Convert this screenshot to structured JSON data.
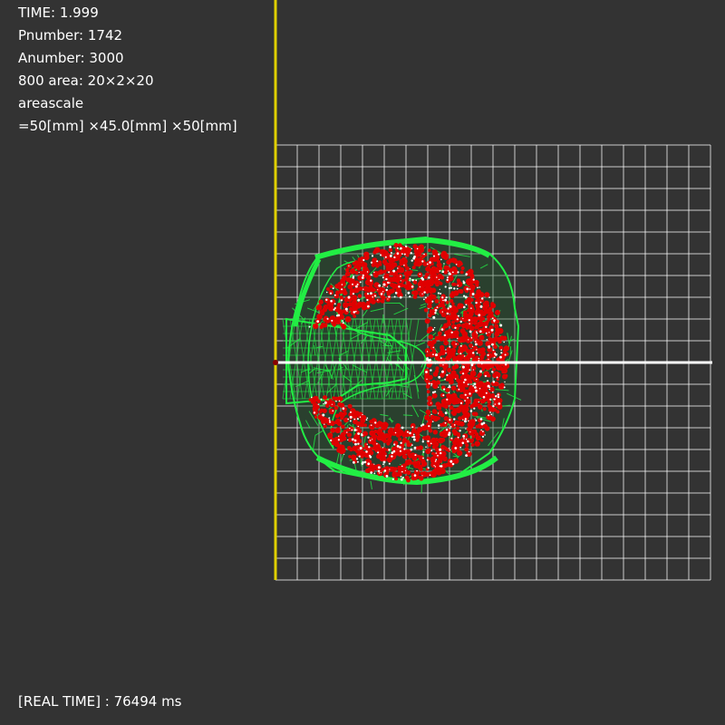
{
  "hud": {
    "time": "TIME: 1.999",
    "pnumber": "Pnumber: 1742",
    "anumber": "Anumber: 3000",
    "area": "800 area: 20×2×20",
    "areascale": "areascale",
    "scale": "=50[mm] ×45.0[mm] ×50[mm]"
  },
  "footer": {
    "real_time": "[REAL TIME] : 76494 ms"
  },
  "colors": {
    "background": "#333333",
    "grid": "#ffffff",
    "x_axis_positive": "#ffffff",
    "x_axis_negative": "#cc0000",
    "y_axis": "#e0d000",
    "particles_red": "#e00000",
    "mesh_green": "#22ee44"
  },
  "scene": {
    "grid_columns": 20,
    "grid_rows": 20,
    "simulated_object": "c-shaped particle body"
  }
}
